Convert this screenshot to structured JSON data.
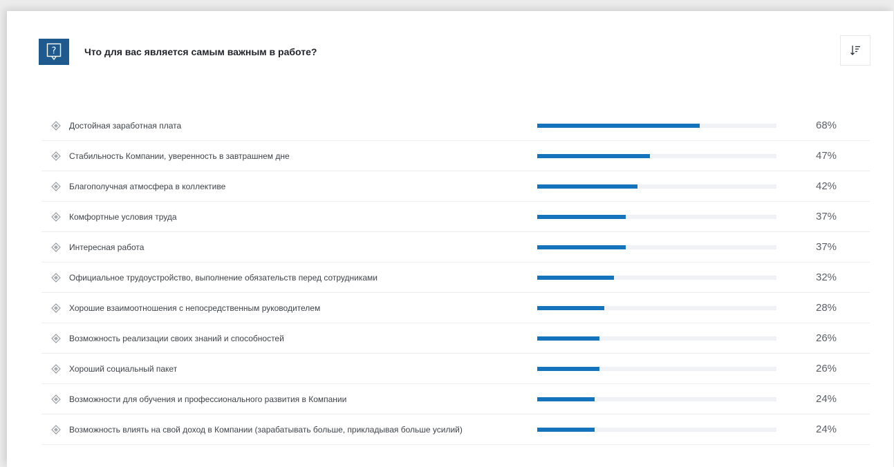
{
  "header": {
    "title": "Что для вас является самым важным в работе?",
    "icon": "question-bubble-icon",
    "sort_icon": "sort-descending-icon"
  },
  "colors": {
    "accent": "#1473bd",
    "icon_bg": "#1f5a8e",
    "track": "#f0f1f6"
  },
  "items": [
    {
      "label": "Достойная заработная плата",
      "value": 68,
      "value_text": "68%"
    },
    {
      "label": "Стабильность Компании, уверенность в завтрашнем дне",
      "value": 47,
      "value_text": "47%"
    },
    {
      "label": "Благополучная атмосфера в коллективе",
      "value": 42,
      "value_text": "42%"
    },
    {
      "label": "Комфортные условия труда",
      "value": 37,
      "value_text": "37%"
    },
    {
      "label": "Интересная работа",
      "value": 37,
      "value_text": "37%"
    },
    {
      "label": "Официальное трудоустройство, выполнение обязательств перед сотрудниками",
      "value": 32,
      "value_text": "32%"
    },
    {
      "label": "Хорошие взаимоотношения с непосредственным руководителем",
      "value": 28,
      "value_text": "28%"
    },
    {
      "label": "Возможность реализации своих знаний и способностей",
      "value": 26,
      "value_text": "26%"
    },
    {
      "label": "Хороший социальный пакет",
      "value": 26,
      "value_text": "26%"
    },
    {
      "label": "Возможности для обучения и профессионального развития в Компании",
      "value": 24,
      "value_text": "24%"
    },
    {
      "label": "Возможность влиять на свой доход в Компании (зарабатывать больше, прикладывая больше усилий)",
      "value": 24,
      "value_text": "24%"
    }
  ]
}
